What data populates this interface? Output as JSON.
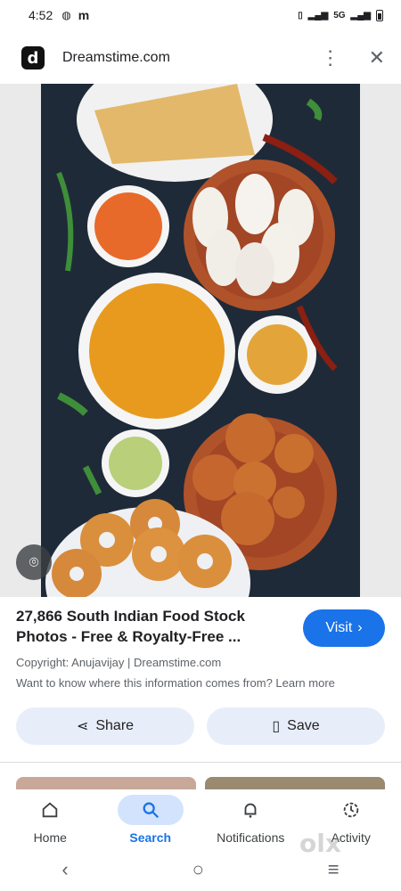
{
  "status_bar": {
    "time": "4:52",
    "left_icons": [
      "sim-icon",
      "m-icon"
    ],
    "network": "5G"
  },
  "header": {
    "site_logo_letter": "d",
    "site_name": "Dreamstime.com"
  },
  "result": {
    "title": "27,866 South Indian Food Stock Photos - Free & Royalty-Free ...",
    "visit_label": "Visit",
    "copyright": "Copyright: Anujavijay | Dreamstime.com",
    "info_prompt": "Want to know where this information comes from? Learn more"
  },
  "actions": {
    "share_label": "Share",
    "save_label": "Save"
  },
  "bottom_nav": [
    {
      "label": "Home",
      "icon": "home-icon",
      "active": false
    },
    {
      "label": "Search",
      "icon": "search-icon",
      "active": true
    },
    {
      "label": "Notifications",
      "icon": "bell-icon",
      "active": false
    },
    {
      "label": "Activity",
      "icon": "history-icon",
      "active": false
    }
  ],
  "watermark": "olx",
  "colors": {
    "accent": "#1a73e8",
    "pill_bg": "#e8eef9",
    "active_nav_bg": "#d3e3fd",
    "image_bg": "#1f2a38"
  }
}
